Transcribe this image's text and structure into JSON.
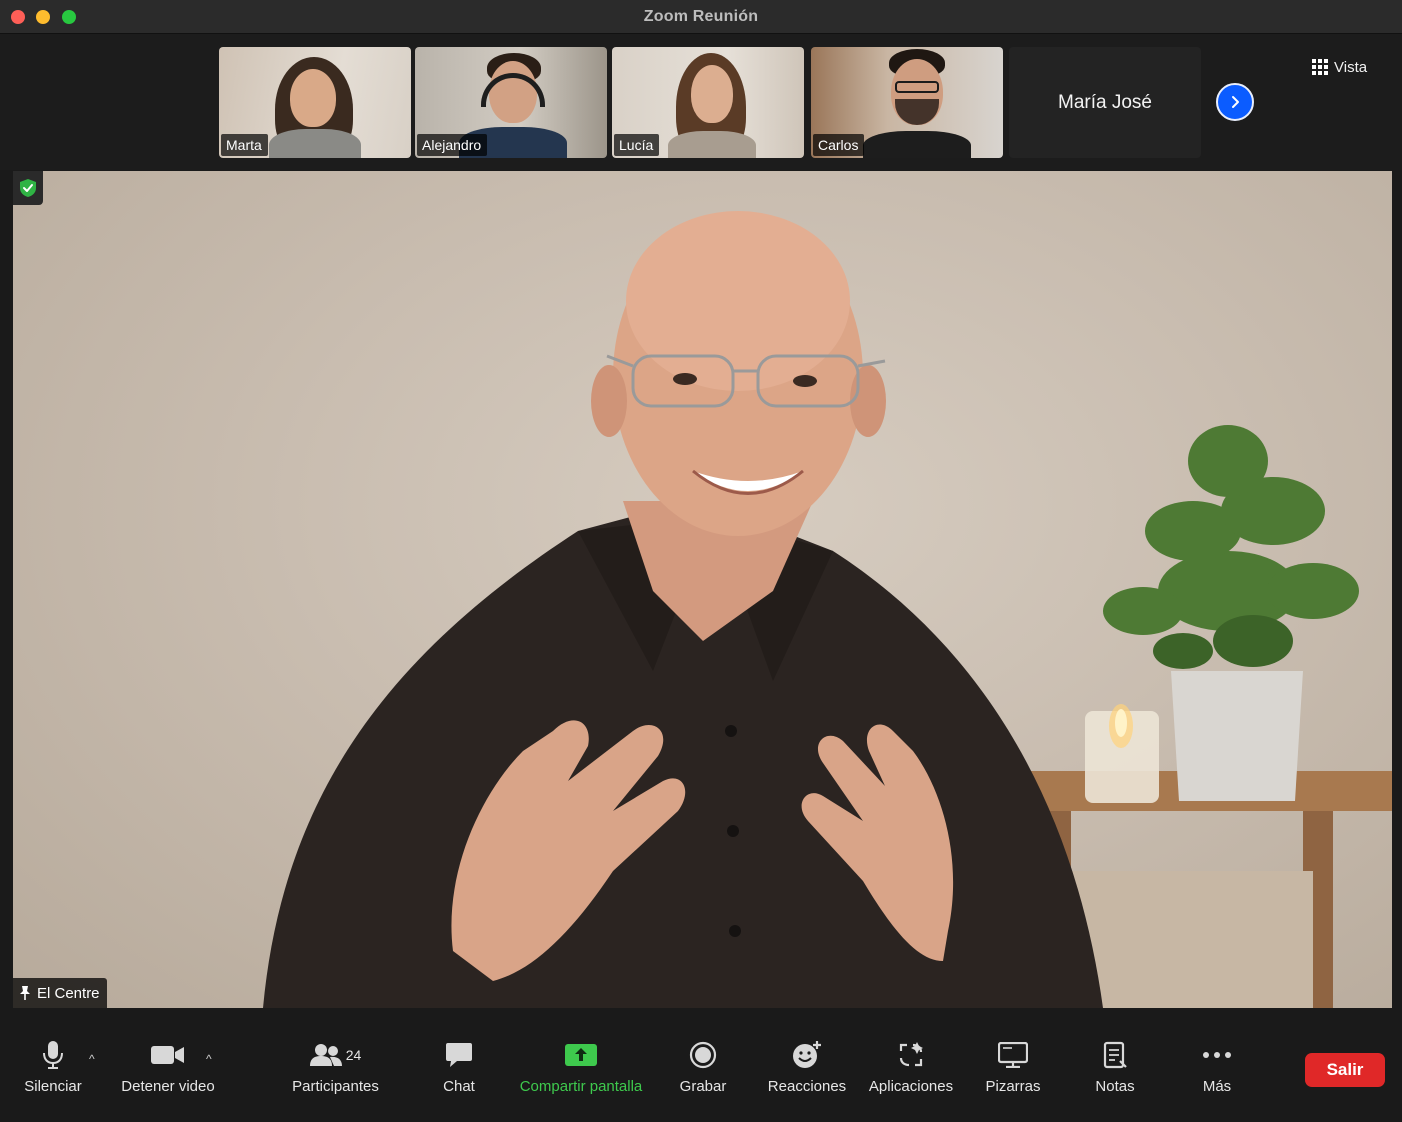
{
  "window": {
    "title": "Zoom Reunión"
  },
  "filmstrip": {
    "participants": [
      {
        "name": "Marta"
      },
      {
        "name": "Alejandro"
      },
      {
        "name": "Lucía"
      },
      {
        "name": "Carlos"
      }
    ],
    "name_only_tile": "María José",
    "next_icon": "chevron-right-icon",
    "view_button": "Vista"
  },
  "main_video": {
    "speaker_label": "El Centre",
    "pin_icon": "pin-icon",
    "security_icon": "shield-check-icon"
  },
  "toolbar": {
    "mute": "Silenciar",
    "stop_video": "Detener video",
    "participants": "Participantes",
    "participants_count": "24",
    "chat": "Chat",
    "share": "Compartir pantalla",
    "record": "Grabar",
    "reactions": "Reacciones",
    "apps": "Aplicaciones",
    "whiteboards": "Pizarras",
    "notes": "Notas",
    "more": "Más",
    "leave": "Salir"
  },
  "colors": {
    "accent": "#0b5cff",
    "share_green": "#3ec94d",
    "leave_red": "#e02828",
    "shield_green": "#2fb344"
  }
}
